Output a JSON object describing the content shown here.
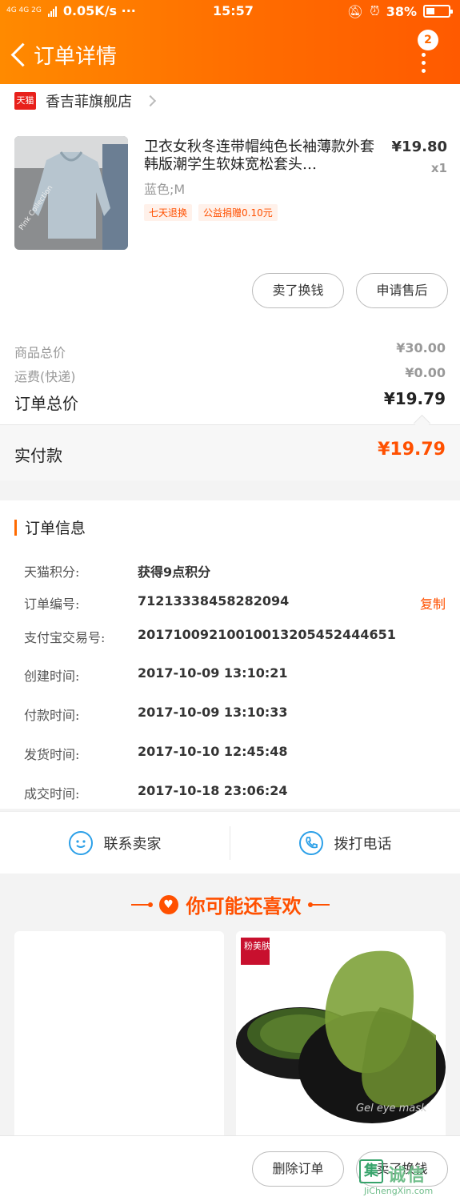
{
  "status_bar": {
    "network": "4G 4G  2G",
    "speed": "0.05K/s ···",
    "time": "15:57",
    "battery_percent": "38%",
    "battery_level": 0.38
  },
  "nav": {
    "title": "订单详情",
    "badge": "2"
  },
  "shop": {
    "badge": "天猫",
    "name": "香吉菲旗舰店"
  },
  "product": {
    "title": "卫衣女秋冬连带帽纯色长袖薄款外套韩版潮学生软妹宽松套头…",
    "price": "¥19.80",
    "qty": "x1",
    "spec": "蓝色;M",
    "tags": [
      "七天退换",
      "公益捐赠0.10元"
    ],
    "image_text": "Pink Collection"
  },
  "actions": {
    "sell": "卖了换钱",
    "after_sale": "申请售后"
  },
  "summary": {
    "goods_label": "商品总价",
    "goods_value": "¥30.00",
    "shipping_label": "运费(快递)",
    "shipping_value": "¥0.00",
    "total_label": "订单总价",
    "total_value": "¥19.79",
    "paid_label": "实付款",
    "paid_value": "¥19.79"
  },
  "order_info": {
    "heading": "订单信息",
    "rows": [
      {
        "k": "天猫积分:",
        "v": "获得9点积分"
      },
      {
        "k": "订单编号:",
        "v": "71213338458282094"
      },
      {
        "k": "支付宝交易号:",
        "v": "20171009210010013205452444651"
      },
      {
        "k": "创建时间:",
        "v": "2017-10-09 13:10:21"
      },
      {
        "k": "付款时间:",
        "v": "2017-10-09 13:10:33"
      },
      {
        "k": "发货时间:",
        "v": "2017-10-10 12:45:48"
      },
      {
        "k": "成交时间:",
        "v": "2017-10-18 23:06:24"
      }
    ],
    "copy": "复制"
  },
  "contact": {
    "seller": "联系卖家",
    "call": "拨打电话"
  },
  "recommend": {
    "title": "你可能还喜欢",
    "brand_text": "粉美肤康",
    "product_text": "Gel eye mask"
  },
  "bottom": {
    "delete": "删除订单",
    "sell": "卖了换钱"
  },
  "watermark": {
    "box": "集",
    "cn": "诚信",
    "en": "JiChengXin.com"
  },
  "colors": {
    "header": "#ff6a00",
    "accent": "#ff5000",
    "contact_icon": "#2ca0e8"
  }
}
